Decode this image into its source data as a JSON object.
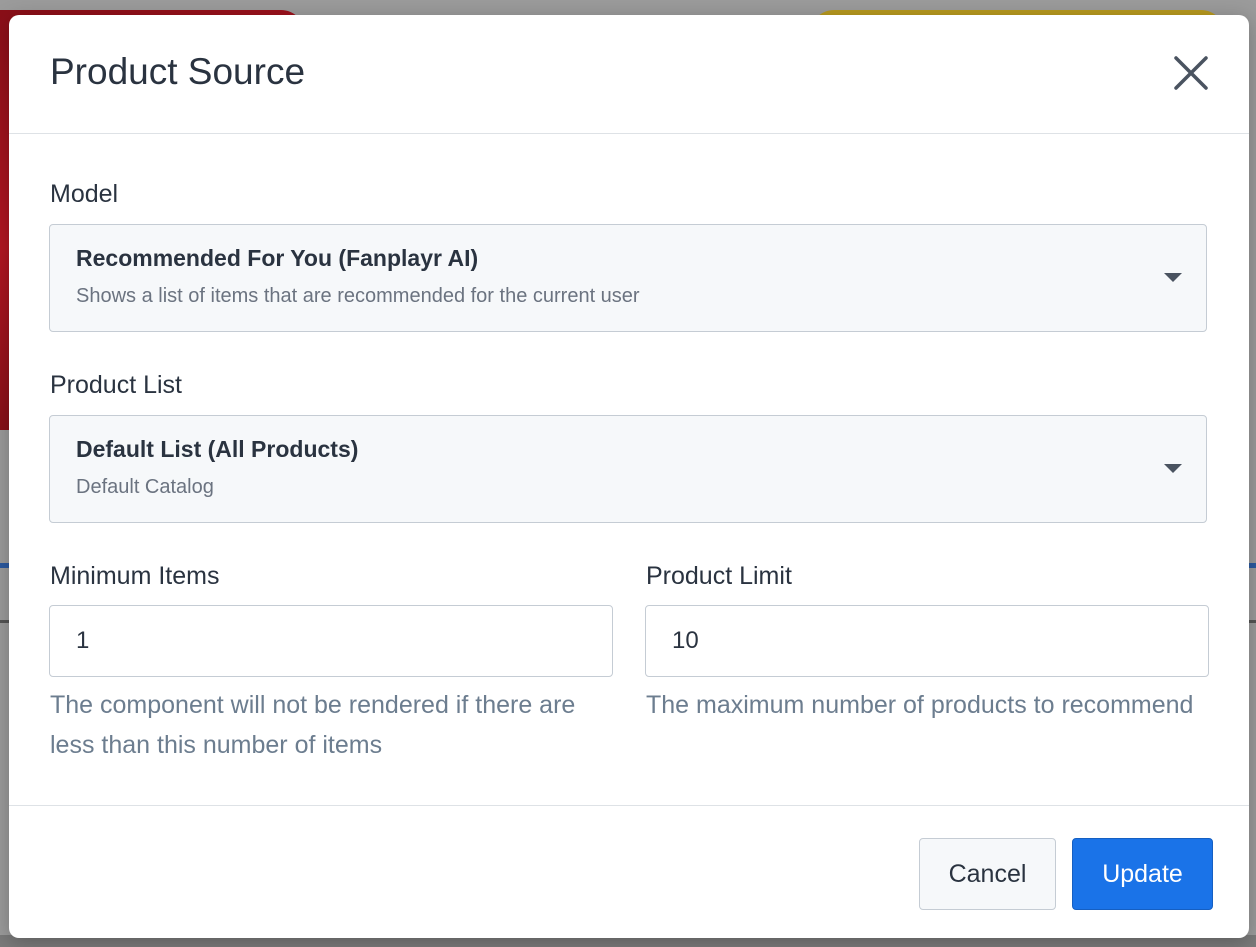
{
  "modal": {
    "title": "Product Source",
    "close_icon": "close-icon"
  },
  "model": {
    "label": "Model",
    "selected_title": "Recommended For You (Fanplayr AI)",
    "selected_description": "Shows a list of items that are recommended for the current user"
  },
  "product_list": {
    "label": "Product List",
    "selected_title": "Default List (All Products)",
    "selected_description": "Default Catalog"
  },
  "minimum_items": {
    "label": "Minimum Items",
    "value": "1",
    "help": "The component will not be rendered if there are less than this number of items"
  },
  "product_limit": {
    "label": "Product Limit",
    "value": "10",
    "help": "The maximum number of products to recommend"
  },
  "footer": {
    "cancel_label": "Cancel",
    "update_label": "Update"
  },
  "colors": {
    "primary": "#1a73e8",
    "text": "#2a3340",
    "help_text": "#6c7d8f"
  }
}
